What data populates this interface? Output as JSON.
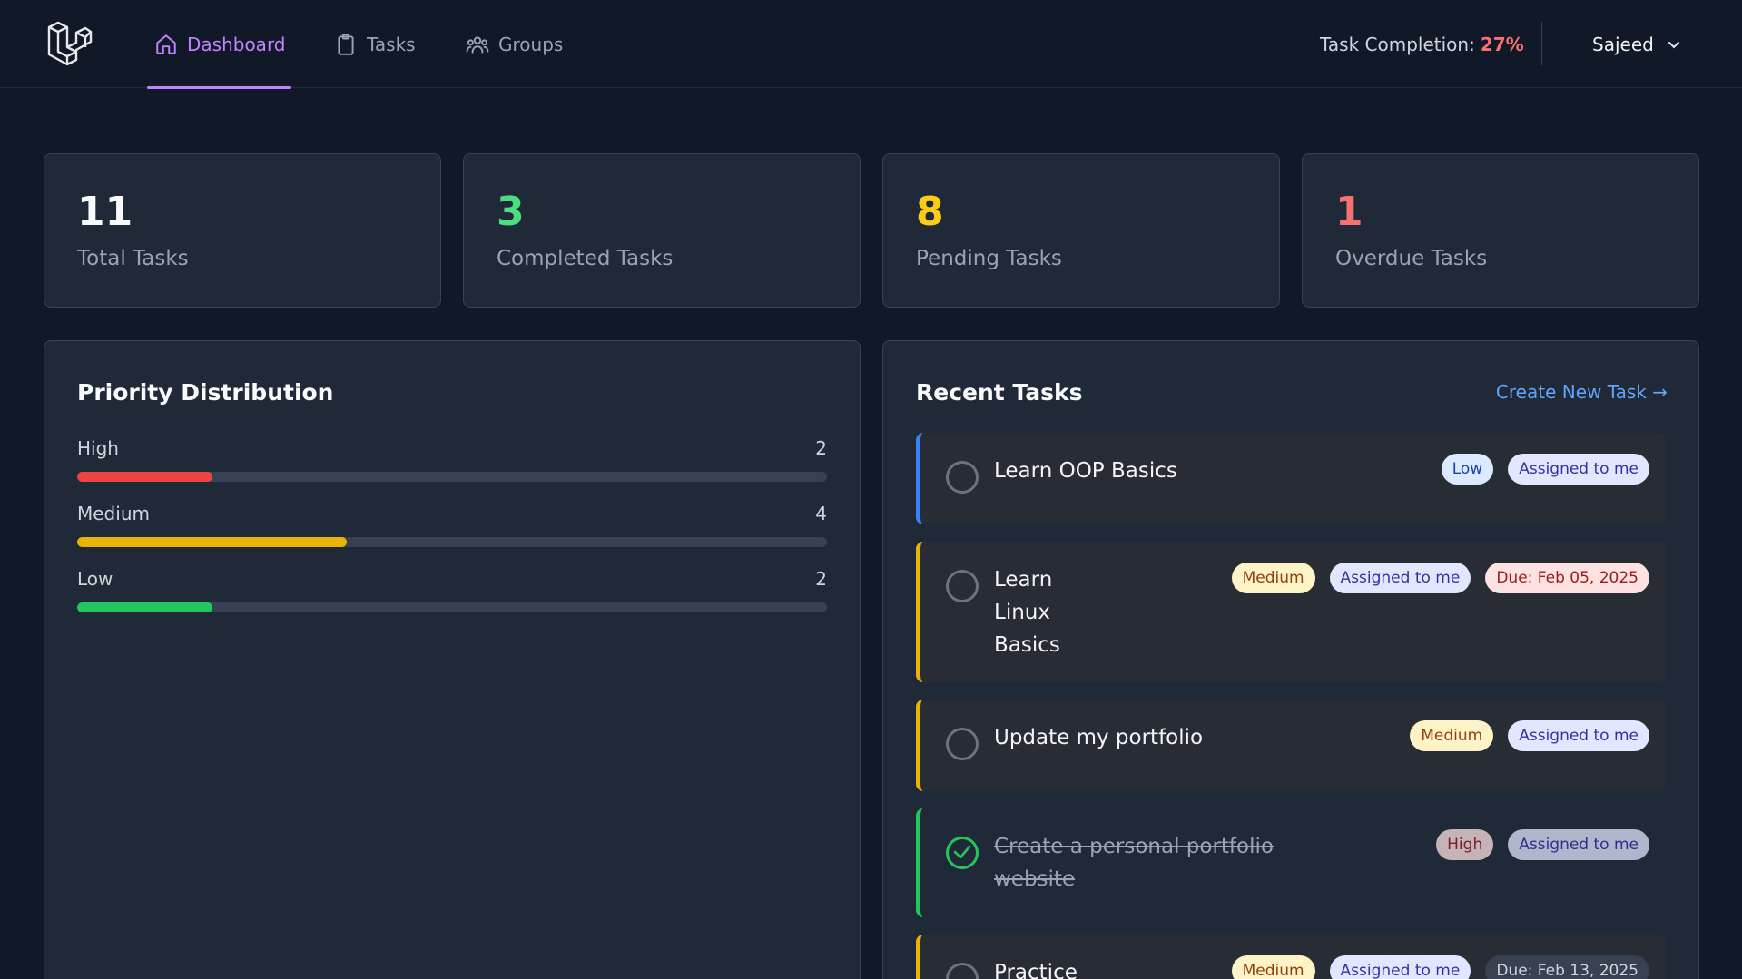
{
  "nav": {
    "links": [
      {
        "label": "Dashboard",
        "icon": "home-icon"
      },
      {
        "label": "Tasks",
        "icon": "clipboard-icon"
      },
      {
        "label": "Groups",
        "icon": "users-icon"
      }
    ],
    "completion_label": "Task Completion:",
    "completion_value": "27%",
    "user_name": "Sajeed"
  },
  "stats": [
    {
      "value": "11",
      "label": "Total Tasks",
      "color": "#f9fafb"
    },
    {
      "value": "3",
      "label": "Completed Tasks",
      "color": "#4ade80"
    },
    {
      "value": "8",
      "label": "Pending Tasks",
      "color": "#facc15"
    },
    {
      "value": "1",
      "label": "Overdue Tasks",
      "color": "#f87171"
    }
  ],
  "priority": {
    "title": "Priority Distribution",
    "rows": [
      {
        "label": "High",
        "value": "2",
        "fraction": 0.18,
        "color": "#ef4444"
      },
      {
        "label": "Medium",
        "value": "4",
        "fraction": 0.36,
        "color": "#eab308"
      },
      {
        "label": "Low",
        "value": "2",
        "fraction": 0.18,
        "color": "#22c55e"
      }
    ]
  },
  "recent": {
    "title": "Recent Tasks",
    "create_link": "Create New Task →",
    "tasks": [
      {
        "title": "Learn OOP Basics",
        "priority": "Low",
        "assigned": "Assigned to me",
        "due": "",
        "completed": false,
        "accent": "#3b82f6"
      },
      {
        "title": "Learn\nLinux\nBasics",
        "priority": "Medium",
        "assigned": "Assigned to me",
        "due": "Due: Feb 05, 2025",
        "completed": false,
        "accent": "#eab308"
      },
      {
        "title": "Update my portfolio",
        "priority": "Medium",
        "assigned": "Assigned to me",
        "due": "",
        "completed": false,
        "accent": "#eab308"
      },
      {
        "title": "Create a personal portfolio\nwebsite",
        "priority": "High",
        "assigned": "Assigned to me",
        "due": "",
        "completed": true,
        "accent": "#22c55e"
      },
      {
        "title": "Practice",
        "priority": "Medium",
        "assigned": "Assigned to me",
        "due": "Due: Feb 13, 2025",
        "completed": false,
        "accent": "#eab308"
      }
    ]
  }
}
